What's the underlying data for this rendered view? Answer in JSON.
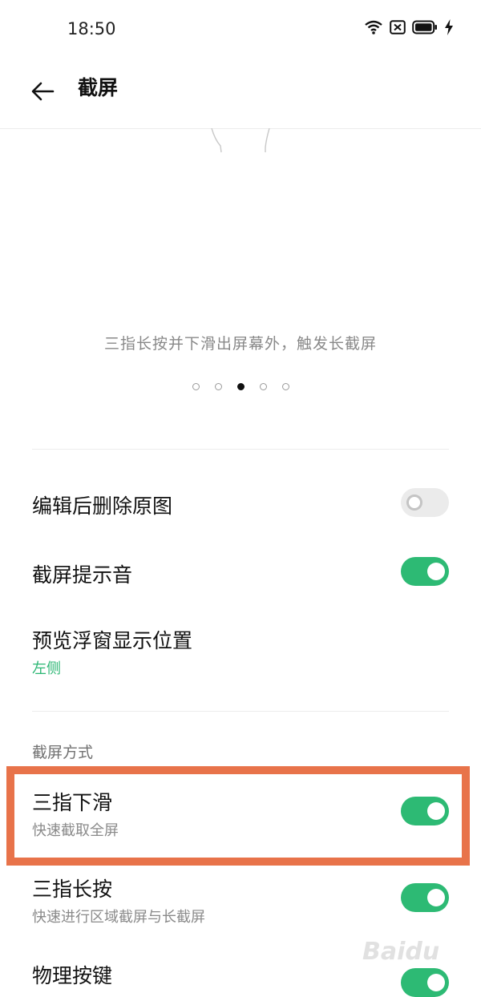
{
  "status_bar": {
    "time": "18:50",
    "icons": [
      "wifi-icon",
      "sim-x-icon",
      "battery-icon",
      "charging-bolt-icon"
    ]
  },
  "app_bar": {
    "back_icon": "arrow-left-icon",
    "title": "截屏"
  },
  "tutorial": {
    "caption": "三指长按并下滑出屏幕外，触发长截屏",
    "page_count": 5,
    "active_page": 3
  },
  "settings": {
    "delete_original": {
      "label": "编辑后删除原图",
      "enabled": false
    },
    "shutter_sound": {
      "label": "截屏提示音",
      "enabled": true
    },
    "preview_position": {
      "label": "预览浮窗显示位置",
      "value": "左侧"
    }
  },
  "methods": {
    "header": "截屏方式",
    "three_finger_swipe": {
      "label": "三指下滑",
      "description": "快速截取全屏",
      "enabled": true
    },
    "three_finger_hold": {
      "label": "三指长按",
      "description": "快速进行区域截屏与长截屏",
      "enabled": true
    },
    "physical_keys": {
      "label": "物理按键",
      "enabled": true
    }
  },
  "colors": {
    "accent": "#2dba74",
    "highlight_border": "#e8734a",
    "toggle_off": "#ebebeb"
  }
}
